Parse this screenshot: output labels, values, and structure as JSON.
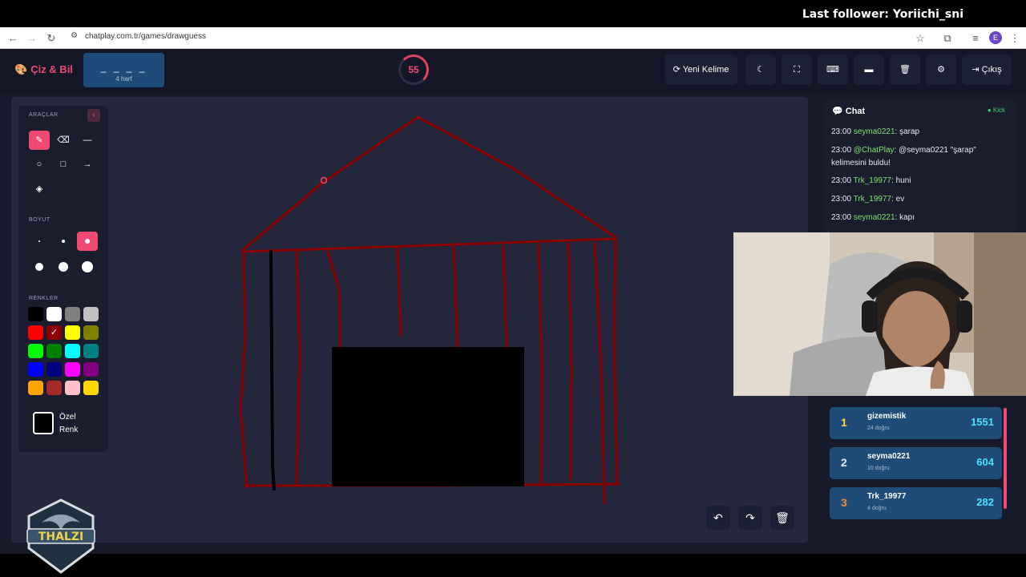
{
  "stream": {
    "last_follower": "Last follower: Yoriichi_sni"
  },
  "browser": {
    "url": "chatplay.com.tr/games/drawguess",
    "profile_initial": "E"
  },
  "header": {
    "logo": "Çiz & Bil",
    "word_mask": "_ _ _ _",
    "word_length": "4 harf",
    "timer": "55",
    "new_word": "Yeni Kelime",
    "exit": "Çıkış"
  },
  "tools": {
    "tools_title": "ARAÇLAR",
    "size_title": "BOYUT",
    "colors_title": "RENKLER",
    "custom_line1": "Özel",
    "custom_line2": "Renk",
    "colors": [
      "#000000",
      "#ffffff",
      "#808080",
      "#c0c0c0",
      "#ff0000",
      "#8b0000",
      "#ffff00",
      "#808000",
      "#00ff00",
      "#008000",
      "#00ffff",
      "#008080",
      "#0000ff",
      "#000080",
      "#ff00ff",
      "#800080",
      "#ffa500",
      "#a52a2a",
      "#ffc0cb",
      "#ffd700"
    ],
    "selected_color": "#8b0000"
  },
  "chat": {
    "title": "Chat",
    "platform": "Kick",
    "messages": [
      {
        "time": "23:00",
        "user": "seyma0221",
        "text": ": şarap"
      },
      {
        "time": "23:00",
        "user": "@ChatPlay",
        "text": ": @seyma0221 \"şarap\" kelimesini buldu!"
      },
      {
        "time": "23:00",
        "user": "Trk_19977",
        "text": ": huni"
      },
      {
        "time": "23:00",
        "user": "Trk_19977",
        "text": ": ev"
      },
      {
        "time": "23:00",
        "user": "seyma0221",
        "text": ": kapı"
      }
    ]
  },
  "leaderboard": [
    {
      "rank": "1",
      "name": "gizemistik",
      "sub": "24 doğru",
      "score": "1551",
      "color": "#ffd84a"
    },
    {
      "rank": "2",
      "name": "seyma0221",
      "sub": "10 doğru",
      "score": "604",
      "color": "#e8edf5"
    },
    {
      "rank": "3",
      "name": "Trk_19977",
      "sub": "4 doğru",
      "score": "282",
      "color": "#f28b3a"
    }
  ],
  "emblem_text": "THALZI"
}
